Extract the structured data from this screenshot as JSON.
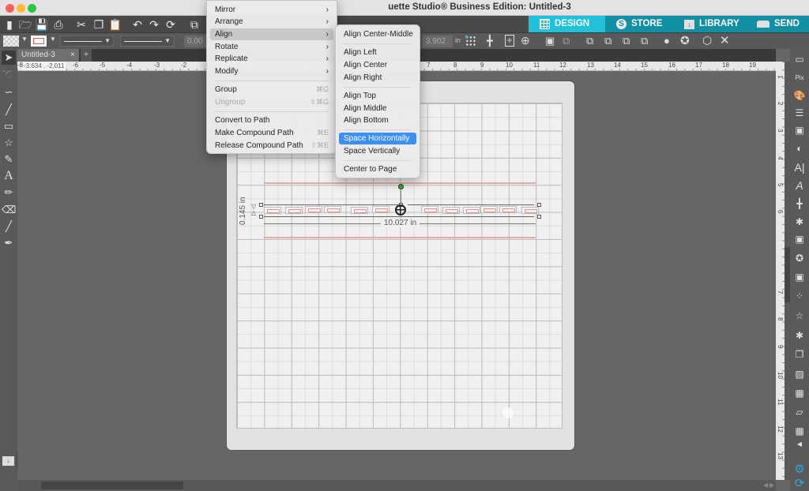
{
  "window": {
    "title": "Silhouette Studio® Business Edition: Untitled-3",
    "title_visible": "uette Studio® Business Edition: Untitled-3"
  },
  "nav_tabs": [
    {
      "label": "DESIGN",
      "icon": "grid-icon",
      "active": true
    },
    {
      "label": "STORE",
      "icon": "silhouette-s-icon",
      "active": false
    },
    {
      "label": "LIBRARY",
      "icon": "library-folder-icon",
      "active": false
    },
    {
      "label": "SEND",
      "icon": "cutter-icon",
      "active": false
    }
  ],
  "toolbar": {
    "icons": [
      "new-document-icon",
      "open-folder-icon",
      "save-icon",
      "print-icon",
      "cut-icon",
      "copy-icon",
      "paste-icon",
      "undo-icon",
      "redo-icon",
      "redraw-icon",
      "select-all-icon"
    ],
    "line_width_value": "0.00",
    "y_value": "3.902",
    "unit": "in"
  },
  "document_tab": {
    "label": "Untitled-3",
    "close": "×",
    "add": "+"
  },
  "ruler": {
    "coords": "-3.634 , -2.011",
    "h_ticks": [
      "-8",
      "-6",
      "-5",
      "-4",
      "-3",
      "-2",
      "7",
      "8",
      "9",
      "10",
      "11",
      "12",
      "13",
      "14",
      "15",
      "16",
      "17",
      "18",
      "19"
    ],
    "v_ticks": [
      "1",
      "2",
      "3",
      "4",
      "5",
      "6",
      "7",
      "8",
      "9",
      "10",
      "11",
      "12",
      "13"
    ]
  },
  "main_menu": {
    "items": [
      {
        "label": "Mirror",
        "submenu": true
      },
      {
        "label": "Arrange",
        "submenu": true
      },
      {
        "label": "Align",
        "submenu": true,
        "highlighted": true
      },
      {
        "label": "Rotate",
        "submenu": true
      },
      {
        "label": "Replicate",
        "submenu": true
      },
      {
        "label": "Modify",
        "submenu": true
      },
      {
        "label": "Group",
        "shortcut": "⌘G"
      },
      {
        "label": "Ungroup",
        "shortcut": "⇧⌘G",
        "disabled": true
      },
      {
        "label": "Convert to Path"
      },
      {
        "label": "Make Compound Path",
        "shortcut": "⌘E"
      },
      {
        "label": "Release Compound Path",
        "shortcut": "⇧⌘E"
      }
    ]
  },
  "align_submenu": {
    "items": [
      {
        "label": "Align Center-Middle"
      },
      {
        "label": "Align Left"
      },
      {
        "label": "Align Center"
      },
      {
        "label": "Align Right"
      },
      {
        "label": "Align Top"
      },
      {
        "label": "Align Middle"
      },
      {
        "label": "Align Bottom"
      },
      {
        "label": "Space Horizontally",
        "selected": true
      },
      {
        "label": "Space Vertically"
      },
      {
        "label": "Center to Page"
      }
    ]
  },
  "selection": {
    "width_label": "10.027 in",
    "height_label": "0.145 in"
  },
  "colors": {
    "accent": "#21c1dc",
    "nav_bg": "#118fa3",
    "menu_selected": "#3b8ff5",
    "cut_line": "#e48f8f"
  }
}
